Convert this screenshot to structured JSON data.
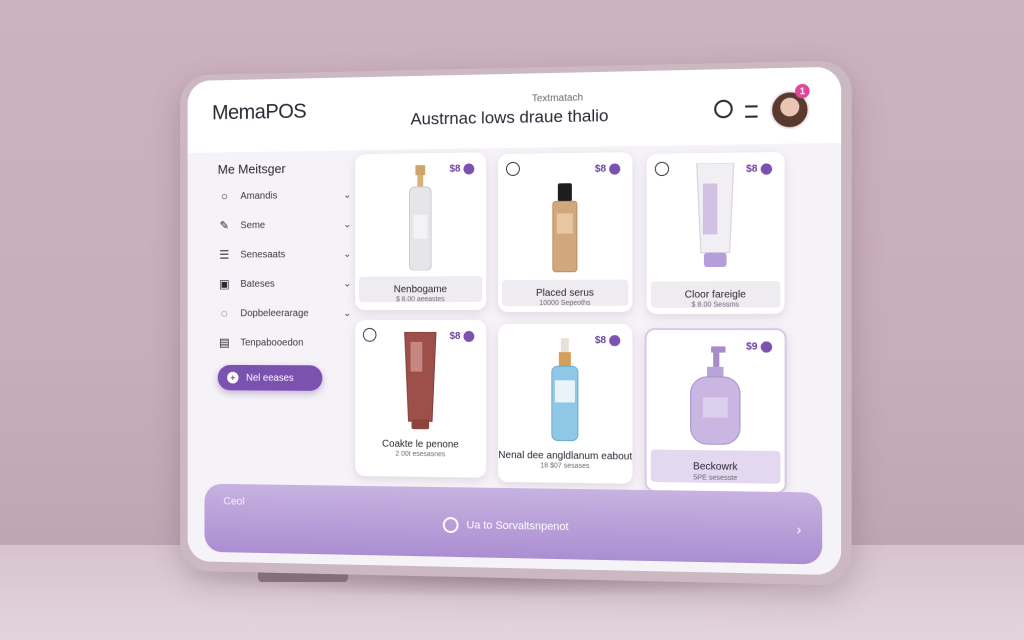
{
  "app": {
    "logo": "MemaPOS",
    "header_subtitle": "Textmatach",
    "header_title": "Austrnac lows draue thalio",
    "notification_count": "1"
  },
  "sidebar": {
    "heading": "Me Meitsger",
    "items": [
      {
        "label": "Amandis",
        "icon": "circle-icon"
      },
      {
        "label": "Seme",
        "icon": "dropper-icon"
      },
      {
        "label": "Senesaats",
        "icon": "list-icon"
      },
      {
        "label": "Bateses",
        "icon": "box-icon"
      },
      {
        "label": "Dopbeleerarage",
        "icon": "drop-icon"
      },
      {
        "label": "Tenpabooedon",
        "icon": "doc-icon"
      }
    ],
    "new_button": "Nel eeases"
  },
  "products": [
    {
      "name": "Nenbogame",
      "meta": "$ 8.00 aeeastes",
      "price": "$8",
      "selected": false
    },
    {
      "name": "Placed serus",
      "meta": "10000 Sepeoths",
      "price": "$8",
      "selected": false
    },
    {
      "name": "Cloor fareigle",
      "meta": "$ 8.00 Sessms",
      "price": "$8",
      "selected": false
    },
    {
      "name": "Coakte le penone",
      "meta": "2 00t esesasnes",
      "price": "$8",
      "selected": false
    },
    {
      "name": "Nenal dee angldlanum eabout",
      "meta": "18 $07 sesases",
      "price": "$8",
      "selected": false
    },
    {
      "name": "Beckowrk",
      "meta": "5PE sesesste",
      "price": "$9",
      "selected": true
    }
  ],
  "bottom_bar": {
    "left_label": "Ceol",
    "action_label": "Ua to Sorvaltsnpenot"
  },
  "colors": {
    "accent": "#7c52b0",
    "bottom_bar": "#b89bd8",
    "badge": "#e0489a"
  }
}
